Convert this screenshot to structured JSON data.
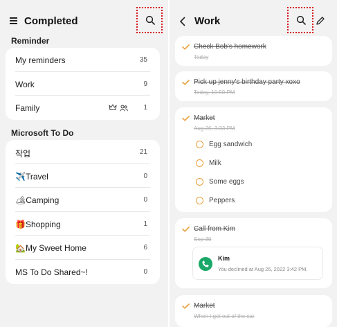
{
  "left": {
    "title": "Completed",
    "sections": [
      {
        "label": "Reminder",
        "items": [
          {
            "label": "My reminders",
            "count": "35"
          },
          {
            "label": "Work",
            "count": "9"
          },
          {
            "label": "Family",
            "count": "1"
          }
        ]
      },
      {
        "label": "Microsoft To Do",
        "items": [
          {
            "label": "작업",
            "count": "21"
          },
          {
            "label": "✈️Travel",
            "count": "0"
          },
          {
            "label": "🏕Camping",
            "count": "0"
          },
          {
            "label": "🎁Shopping",
            "count": "1"
          },
          {
            "label": "🏡My Sweet Home",
            "count": "6"
          },
          {
            "label": "MS To Do Shared~!",
            "count": "0"
          }
        ]
      }
    ]
  },
  "right": {
    "title": "Work",
    "tasks": [
      {
        "title": "Check Bob's homework",
        "date": "Today"
      },
      {
        "title": "Pick up jenny's birthday party xoxo",
        "date": "Today, 10:50 PM"
      },
      {
        "title": "Market",
        "date": "Aug 26, 3:33 PM",
        "subtasks": [
          "Egg sandwich",
          "Milk",
          "Some eggs",
          "Peppers"
        ]
      },
      {
        "title": "Call from Kim",
        "date": "Sep 30",
        "call": {
          "name": "Kim",
          "message": "You declined at Aug 26, 2022 3:42 PM."
        }
      },
      {
        "title": "Market",
        "date": "When I get out of the car"
      }
    ]
  },
  "colors": {
    "accent": "#e8a13c",
    "highlight": "#d4181f",
    "call_green": "#1aa868",
    "background": "#f2f2f2"
  },
  "icons": [
    "menu-icon",
    "search-icon",
    "back-icon",
    "edit-icon",
    "crown-icon",
    "shared-people-icon",
    "check-icon",
    "phone-icon"
  ]
}
